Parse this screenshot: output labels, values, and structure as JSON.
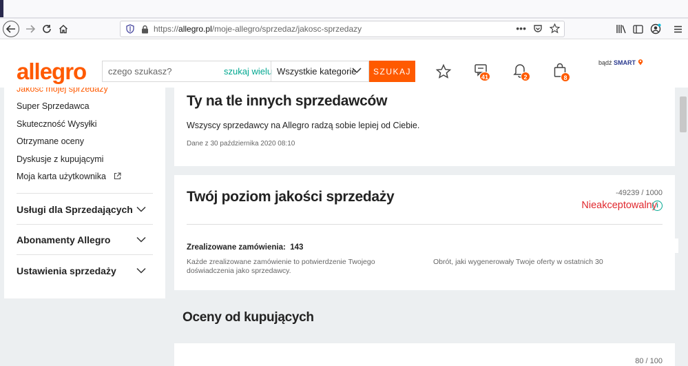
{
  "browser": {
    "url_prefix": "https://",
    "url_domain": "allegro.pl",
    "url_path": "/moje-allegro/sprzedaz/jakosc-sprzedazy",
    "more_label": "•••"
  },
  "header": {
    "logo": "allegro",
    "search_placeholder": "czego szukasz?",
    "search_many": "szukaj wielu",
    "category": "Wszystkie kategorie",
    "search_button": "SZUKAJ",
    "messages_badge": "41",
    "notifications_badge": "2",
    "cart_badge": "8",
    "smart_prefix": "bądź",
    "smart_brand": "SMART"
  },
  "sidebar": {
    "cut_link": "Jakość mojej sprzedaży",
    "links": [
      "Super Sprzedawca",
      "Skuteczność Wysyłki",
      "Otrzymane oceny",
      "Dyskusje z kupującymi",
      "Moja karta użytkownika"
    ],
    "groups": [
      "Usługi dla Sprzedających",
      "Abonamenty Allegro",
      "Ustawienia sprzedaży"
    ]
  },
  "compare_card": {
    "title": "Ty na tle innych sprzedawców",
    "text": "Wszyscy sprzedawcy na Allegro radzą sobie lepiej od Ciebie.",
    "date": "Dane z 30 października 2020 08:10"
  },
  "quality_card": {
    "title": "Twój poziom jakości sprzedaży",
    "score": "-49239 / 1000",
    "status": "Nieakceptowalny",
    "orders_label": "Zrealizowane zamówienia:",
    "orders_value": "143",
    "desc_left": "Każde zrealizowane zamówienie to potwierdzenie Twojego doświadczenia jako sprzedawcy.",
    "desc_right": "Obrót, jaki wygenerowały Twoje oferty w ostatnich 30"
  },
  "ratings": {
    "title": "Oceny od kupujących",
    "score": "80 / 100"
  },
  "colors": {
    "brand": "#ff5a00",
    "accent": "#00a790",
    "danger": "#e0282e"
  }
}
